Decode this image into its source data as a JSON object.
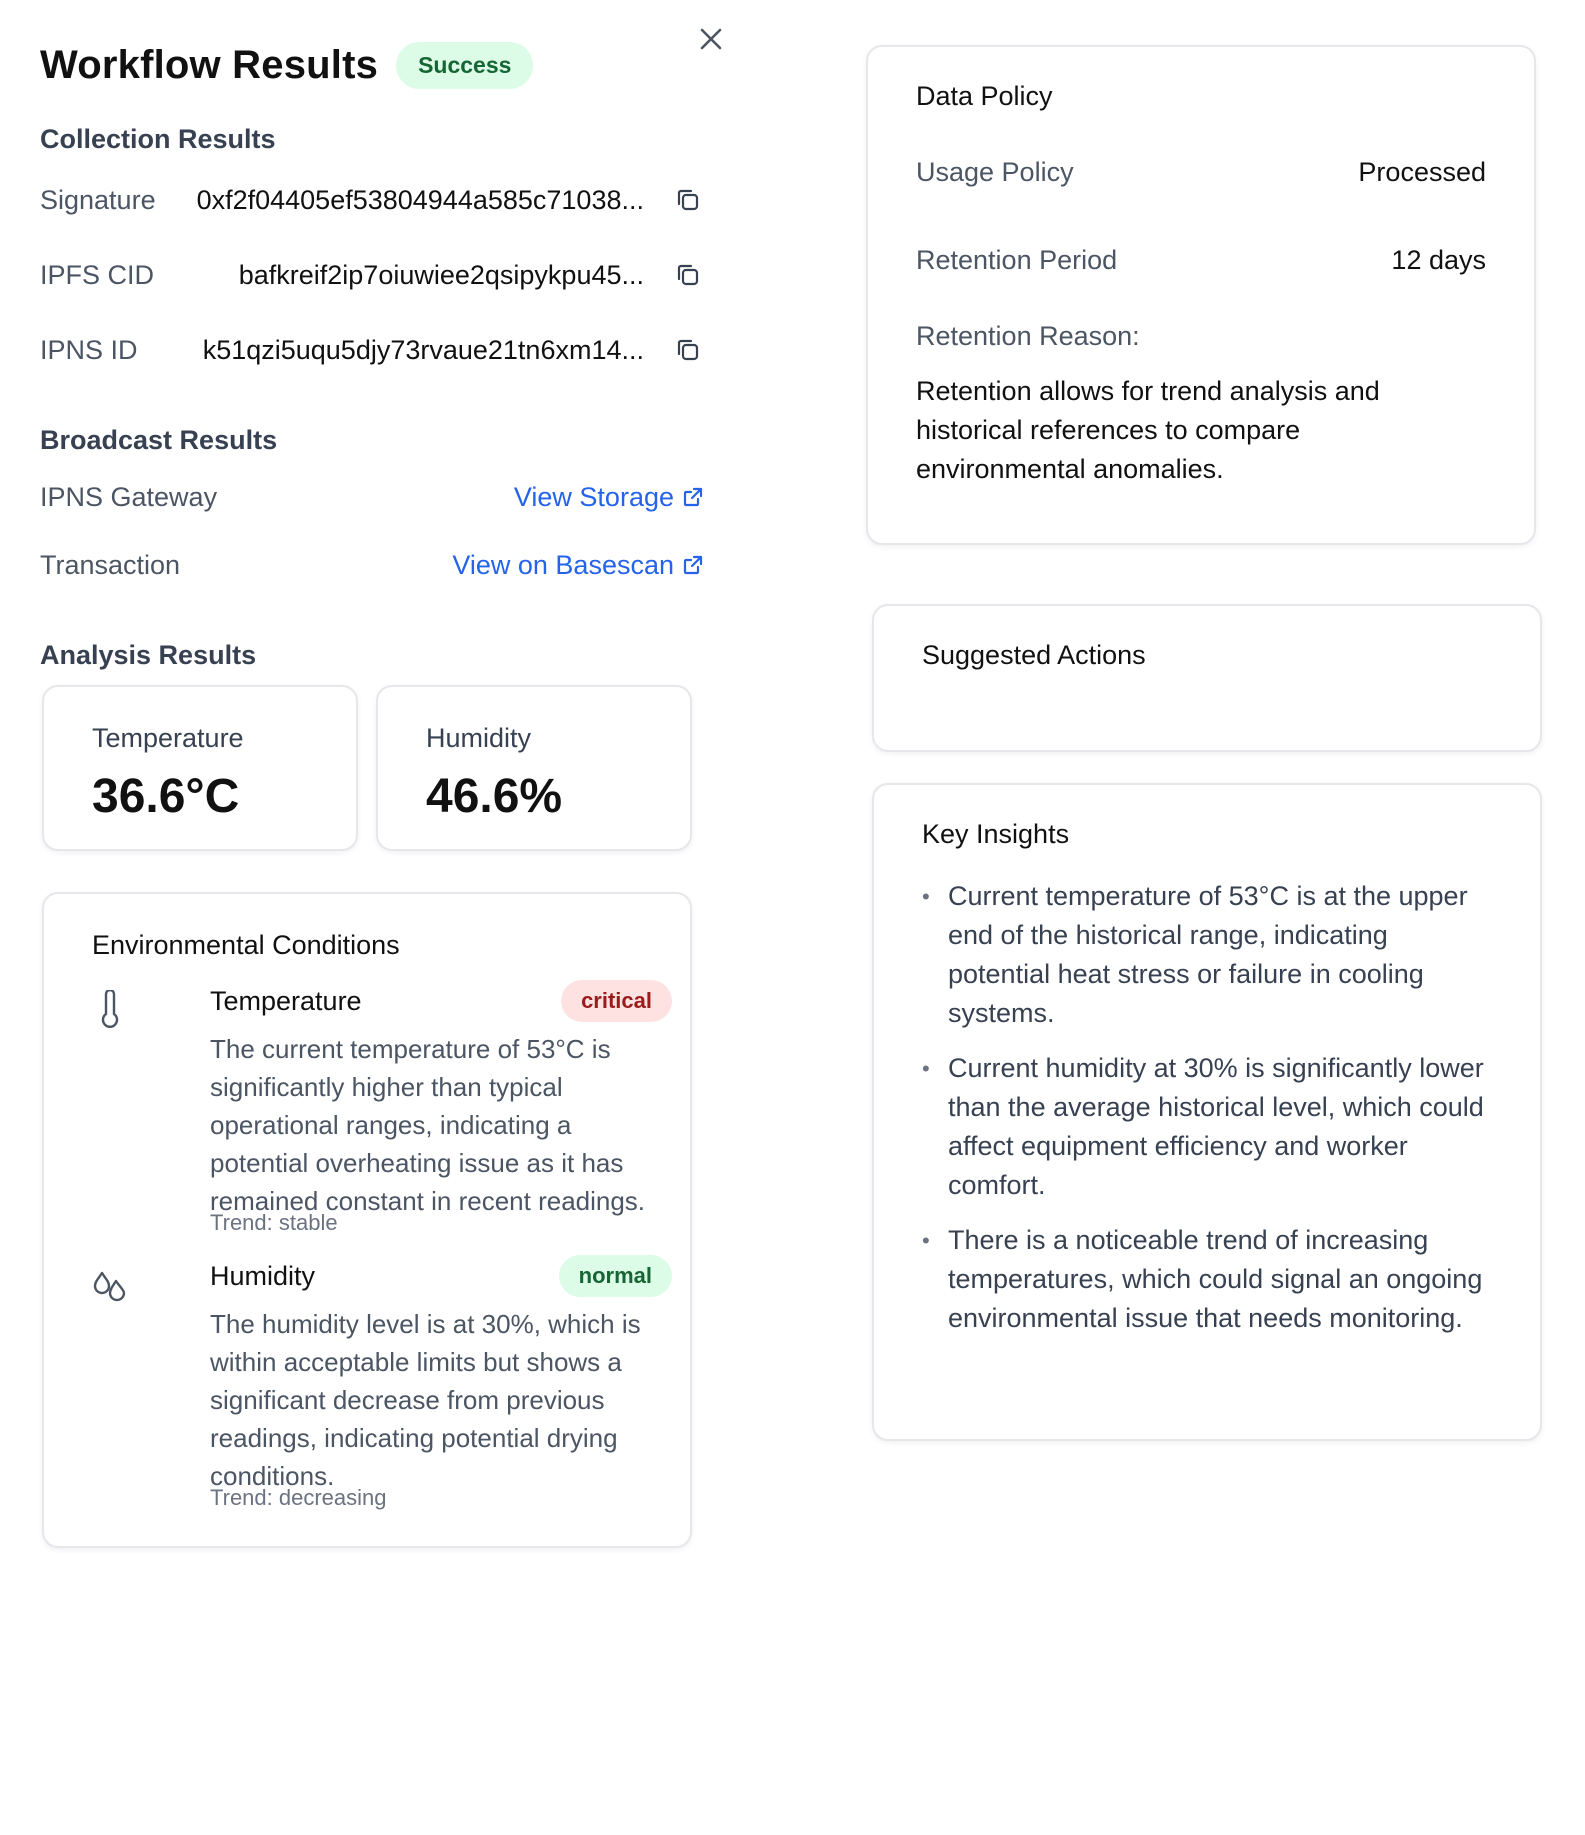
{
  "header": {
    "title": "Workflow Results",
    "status_badge": "Success"
  },
  "collection": {
    "title": "Collection Results",
    "rows": [
      {
        "label": "Signature",
        "value": "0xf2f04405ef53804944a585c71038..."
      },
      {
        "label": "IPFS CID",
        "value": "bafkreif2ip7oiuwiee2qsipykpu45..."
      },
      {
        "label": "IPNS ID",
        "value": "k51qzi5uqu5djy73rvaue21tn6xm14..."
      }
    ]
  },
  "broadcast": {
    "title": "Broadcast Results",
    "rows": [
      {
        "label": "IPNS Gateway",
        "link": "View Storage"
      },
      {
        "label": "Transaction",
        "link": "View on Basescan"
      }
    ]
  },
  "analysis": {
    "title": "Analysis Results",
    "metrics": [
      {
        "label": "Temperature",
        "value": "36.6°C"
      },
      {
        "label": "Humidity",
        "value": "46.6%"
      }
    ]
  },
  "environment": {
    "title": "Environmental Conditions",
    "conditions": [
      {
        "name": "Temperature",
        "status": "critical",
        "icon": "thermometer-icon",
        "description": "The current temperature of 53°C is significantly higher than typical operational ranges, indicating a potential overheating issue as it has remained constant in recent readings.",
        "trend": "Trend: stable"
      },
      {
        "name": "Humidity",
        "status": "normal",
        "icon": "droplets-icon",
        "description": "The humidity level is at 30%, which is within acceptable limits but shows a significant decrease from previous readings, indicating potential drying conditions.",
        "trend": "Trend: decreasing"
      }
    ]
  },
  "data_policy": {
    "title": "Data Policy",
    "usage_label": "Usage Policy",
    "usage_value": "Processed",
    "retention_label": "Retention Period",
    "retention_value": "12 days",
    "reason_label": "Retention Reason:",
    "reason_text": "Retention allows for trend analysis and historical references to compare environmental anomalies."
  },
  "suggested_actions": {
    "title": "Suggested Actions"
  },
  "key_insights": {
    "title": "Key Insights",
    "items": [
      "Current temperature of 53°C is at the upper end of the historical range, indicating potential heat stress or failure in cooling systems.",
      "Current humidity at 30% is significantly lower than the average historical level, which could affect equipment efficiency and worker comfort.",
      "There is a noticeable trend of increasing temperatures, which could signal an ongoing environmental issue that needs monitoring."
    ]
  },
  "colors": {
    "success_bg": "#dcfce7",
    "success_text": "#166534",
    "critical_bg": "#fee2e2",
    "critical_text": "#991b1b",
    "link": "#2563eb"
  }
}
